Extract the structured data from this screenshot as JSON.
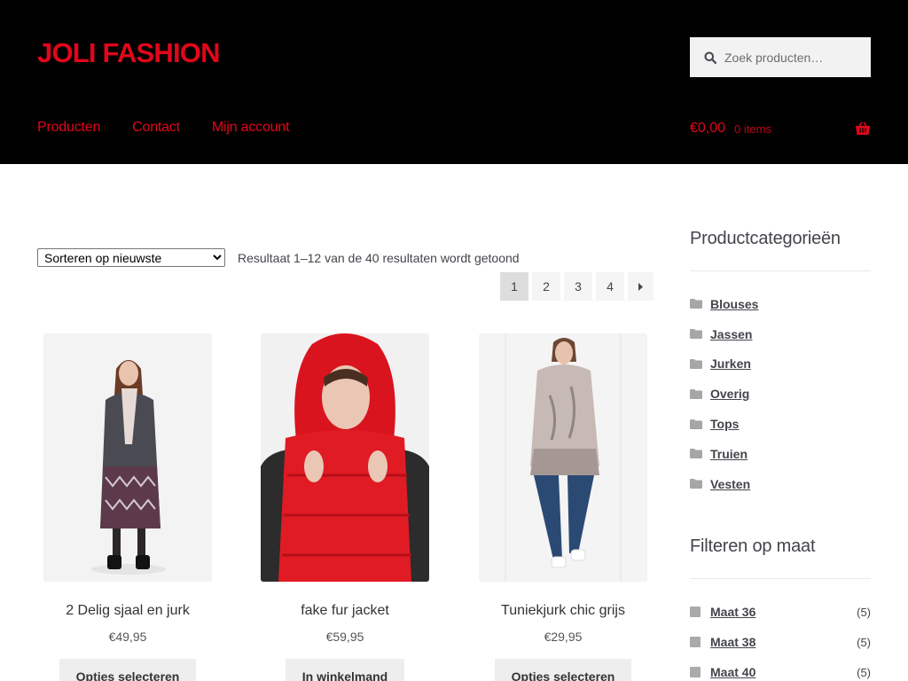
{
  "header": {
    "logo": "JOLI FASHION",
    "search_placeholder": "Zoek producten…",
    "nav": [
      "Producten",
      "Contact",
      "Mijn account"
    ],
    "cart": {
      "amount": "€0,00",
      "count": "0 items"
    }
  },
  "toolbar": {
    "sort_selected": "Sorteren op nieuwste",
    "result_count": "Resultaat 1–12 van de 40 resultaten wordt getoond",
    "pages": [
      "1",
      "2",
      "3",
      "4"
    ],
    "current_page": 1
  },
  "products": [
    {
      "name": "2 Delig sjaal en jurk",
      "price": "€49,95",
      "button": "Opties selecteren"
    },
    {
      "name": "fake fur jacket",
      "price": "€59,95",
      "button": "In winkelmand"
    },
    {
      "name": "Tuniekjurk chic grijs",
      "price": "€29,95",
      "button": "Opties selecteren"
    }
  ],
  "sidebar": {
    "categories_title": "Productcategorieën",
    "categories": [
      "Blouses",
      "Jassen",
      "Jurken",
      "Overig",
      "Tops",
      "Truien",
      "Vesten"
    ],
    "sizes_title": "Filteren op maat",
    "sizes": [
      {
        "label": "Maat 36",
        "count": "(5)"
      },
      {
        "label": "Maat 38",
        "count": "(5)"
      },
      {
        "label": "Maat 40",
        "count": "(5)"
      }
    ]
  },
  "colors": {
    "brand": "#e2061a",
    "header_bg": "#000000"
  }
}
